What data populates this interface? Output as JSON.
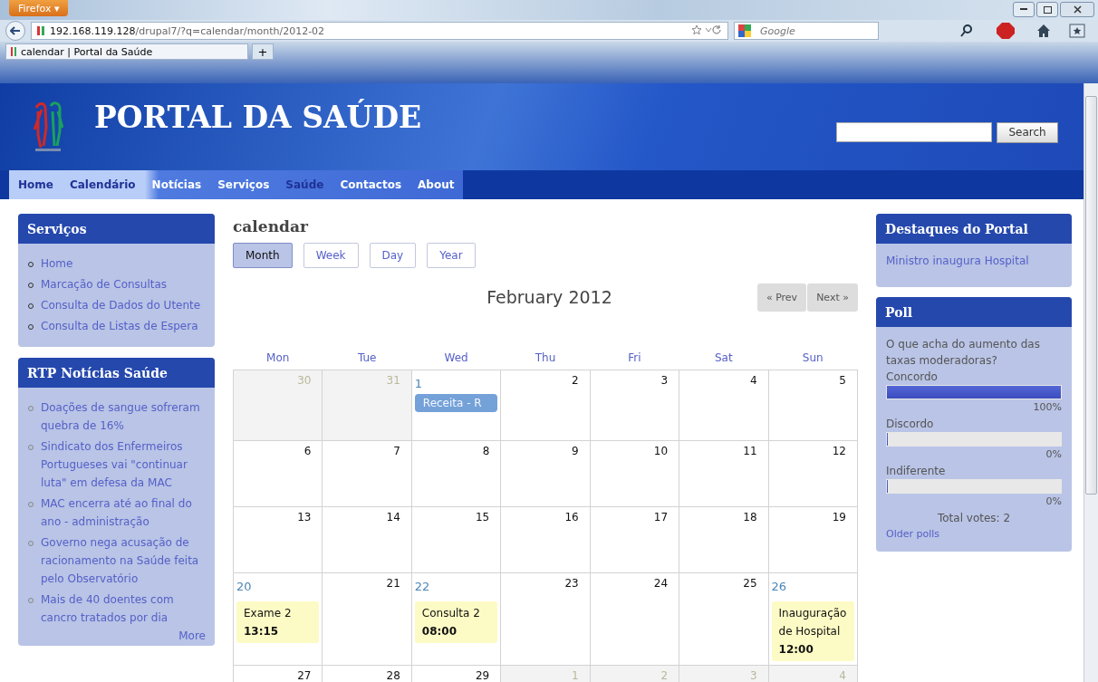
{
  "browser": {
    "menu_button": "Firefox",
    "menu_caret": "▾",
    "url_host": "192.168.119.128",
    "url_path": "/drupal7/?q=calendar/month/2012-02",
    "search_placeholder": "Google",
    "tab_title": "calendar | Portal da Saúde",
    "new_tab": "+"
  },
  "site": {
    "title": "PORTAL DA SAÚDE",
    "search_button": "Search",
    "nav": [
      {
        "label": "Home",
        "light": false
      },
      {
        "label": "Calendário",
        "light": false
      },
      {
        "label": "Notícias",
        "light": true
      },
      {
        "label": "Serviços",
        "light": true
      },
      {
        "label": "Saúde",
        "light": false
      },
      {
        "label": "Contactos",
        "light": true
      },
      {
        "label": "About",
        "light": true
      }
    ]
  },
  "left_blocks": [
    {
      "title": "Serviços",
      "dark_bullets": true,
      "items": [
        "Home",
        "Marcação de Consultas",
        "Consulta de Dados do Utente",
        "Consulta de Listas de Espera"
      ]
    },
    {
      "title": "RTP Notícias Saúde",
      "dark_bullets": false,
      "items": [
        "Doações de sangue sofreram quebra de 16%",
        "Sindicato dos Enfermeiros Portugueses vai \"continuar luta\" em defesa da MAC",
        "MAC encerra até ao final do ano - administração",
        "Governo nega acusação de racionamento na Saúde feita pelo Observatório",
        "Mais de 40 doentes com cancro tratados por dia"
      ],
      "more": "More"
    }
  ],
  "calendar": {
    "title": "calendar",
    "views": [
      {
        "label": "Month",
        "selected": true
      },
      {
        "label": "Week",
        "selected": false
      },
      {
        "label": "Day",
        "selected": false
      },
      {
        "label": "Year",
        "selected": false
      }
    ],
    "month_title": "February 2012",
    "pager": [
      "« Prev",
      "Next »"
    ],
    "weekdays": [
      "Mon",
      "Tue",
      "Wed",
      "Thu",
      "Fri",
      "Sat",
      "Sun"
    ],
    "weeks": [
      [
        {
          "day": "30",
          "other_month": true,
          "linked": false
        },
        {
          "day": "31",
          "other_month": true,
          "linked": false
        },
        {
          "day": "1",
          "other_month": false,
          "linked": true,
          "events": [
            {
              "kind": "bar",
              "title": "Receita - R"
            }
          ]
        },
        {
          "day": "2",
          "other_month": false,
          "linked": false
        },
        {
          "day": "3",
          "other_month": false,
          "linked": false
        },
        {
          "day": "4",
          "other_month": false,
          "linked": false
        },
        {
          "day": "5",
          "other_month": false,
          "linked": false
        }
      ],
      [
        {
          "day": "6",
          "other_month": false,
          "linked": false
        },
        {
          "day": "7",
          "other_month": false,
          "linked": false
        },
        {
          "day": "8",
          "other_month": false,
          "linked": false
        },
        {
          "day": "9",
          "other_month": false,
          "linked": false
        },
        {
          "day": "10",
          "other_month": false,
          "linked": false
        },
        {
          "day": "11",
          "other_month": false,
          "linked": false
        },
        {
          "day": "12",
          "other_month": false,
          "linked": false
        }
      ],
      [
        {
          "day": "13",
          "other_month": false,
          "linked": false
        },
        {
          "day": "14",
          "other_month": false,
          "linked": false
        },
        {
          "day": "15",
          "other_month": false,
          "linked": false
        },
        {
          "day": "16",
          "other_month": false,
          "linked": false
        },
        {
          "day": "17",
          "other_month": false,
          "linked": false
        },
        {
          "day": "18",
          "other_month": false,
          "linked": false
        },
        {
          "day": "19",
          "other_month": false,
          "linked": false
        }
      ],
      [
        {
          "day": "20",
          "other_month": false,
          "linked": true,
          "events": [
            {
              "kind": "timed",
              "title": "Exame 2",
              "time": "13:15"
            }
          ]
        },
        {
          "day": "21",
          "other_month": false,
          "linked": false
        },
        {
          "day": "22",
          "other_month": false,
          "linked": true,
          "events": [
            {
              "kind": "timed",
              "title": "Consulta 2",
              "time": "08:00"
            }
          ]
        },
        {
          "day": "23",
          "other_month": false,
          "linked": false
        },
        {
          "day": "24",
          "other_month": false,
          "linked": false
        },
        {
          "day": "25",
          "other_month": false,
          "linked": false
        },
        {
          "day": "26",
          "other_month": false,
          "linked": true,
          "events": [
            {
              "kind": "timed",
              "title": "Inauguração de Hospital",
              "time": "12:00"
            }
          ]
        }
      ],
      [
        {
          "day": "27",
          "other_month": false,
          "linked": false
        },
        {
          "day": "28",
          "other_month": false,
          "linked": false
        },
        {
          "day": "29",
          "other_month": false,
          "linked": false
        },
        {
          "day": "1",
          "other_month": true,
          "linked": false
        },
        {
          "day": "2",
          "other_month": true,
          "linked": false
        },
        {
          "day": "3",
          "other_month": true,
          "linked": false
        },
        {
          "day": "4",
          "other_month": true,
          "linked": false
        }
      ]
    ]
  },
  "right_blocks": {
    "highlights": {
      "title": "Destaques do Portal",
      "items": [
        "Ministro inaugura Hospital"
      ]
    },
    "poll": {
      "title": "Poll",
      "question": "O que acha do aumento das taxas moderadoras?",
      "choices": [
        {
          "label": "Concordo",
          "level": 1,
          "percent": "100%"
        },
        {
          "label": "Discordo",
          "level": 0,
          "percent": "0%"
        },
        {
          "label": "Indiferente",
          "level": 0,
          "percent": "0%"
        }
      ],
      "total": "Total votes: 2",
      "older": "Older polls"
    }
  }
}
